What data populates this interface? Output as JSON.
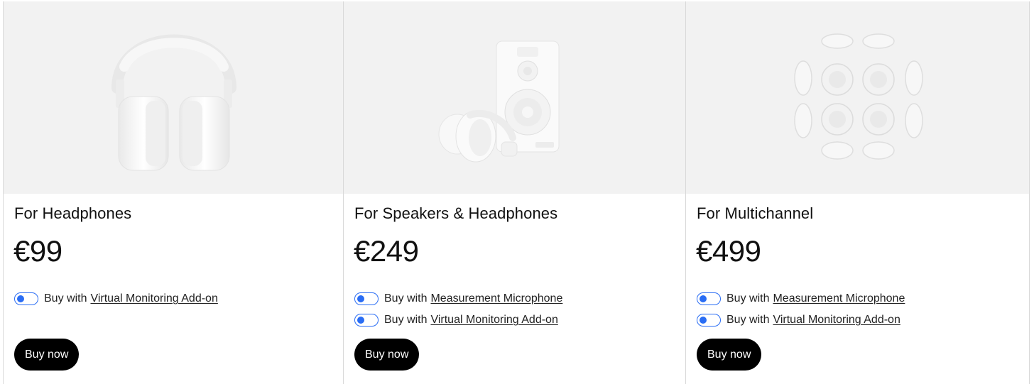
{
  "products": [
    {
      "image_icon": "headphones-image",
      "title": "For Headphones",
      "price": "€99",
      "options": [
        {
          "prefix": "Buy with",
          "link": "Virtual Monitoring Add-on"
        }
      ],
      "button": "Buy now"
    },
    {
      "image_icon": "speaker-and-headphones-image",
      "title": "For Speakers & Headphones",
      "price": "€249",
      "options": [
        {
          "prefix": "Buy with",
          "link": "Measurement Microphone"
        },
        {
          "prefix": "Buy with",
          "link": "Virtual Monitoring Add-on"
        }
      ],
      "button": "Buy now"
    },
    {
      "image_icon": "multichannel-speaker-sphere-image",
      "title": "For Multichannel",
      "price": "€499",
      "options": [
        {
          "prefix": "Buy with",
          "link": "Measurement Microphone"
        },
        {
          "prefix": "Buy with",
          "link": "Virtual Monitoring Add-on"
        }
      ],
      "button": "Buy now"
    }
  ],
  "colors": {
    "toggle_accent": "#2a6df4",
    "button_bg": "#000000",
    "image_bg": "#f2f2f2"
  }
}
